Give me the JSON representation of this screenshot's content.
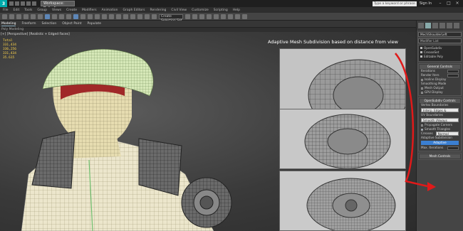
{
  "app": {
    "workspace": "Workspace: Default",
    "search_placeholder": "Type a keyword or phrase",
    "sign_in": "Sign In"
  },
  "menu": [
    "File",
    "Edit",
    "Tools",
    "Group",
    "Views",
    "Create",
    "Modifiers",
    "Animation",
    "Graph Editors",
    "Rendering",
    "Civil View",
    "Customize",
    "Scripting",
    "Help"
  ],
  "toolbar": {
    "view_select": "Create Selection Set"
  },
  "ribbon": {
    "tabs": [
      "Modeling",
      "Freeform",
      "Selection",
      "Object Paint",
      "Populate"
    ],
    "active": "Modeling",
    "sub": "Poly Modeling"
  },
  "viewport": {
    "label": "[+] [Perspective] [Realistic + Edged Faces]",
    "stats": [
      "Total",
      "331,434",
      "336,256",
      "331,434",
      "",
      "35.615"
    ],
    "caption": "Adaptive Mesh Subdivision based on distance from view"
  },
  "command_panel": {
    "object_name": "MechShoulderLeft",
    "modifier_list": "Modifier List",
    "stack": [
      "OpenSubdiv",
      "CreaseSet",
      "Editable Poly"
    ],
    "general_controls": "General Controls",
    "rows": [
      {
        "label": "Iterations",
        "checked": false
      },
      {
        "label": "Render Iters",
        "checked": false
      },
      {
        "label": "Isoline Display",
        "checked": false
      },
      {
        "label": "Smoothing Mode",
        "checked": false
      },
      {
        "label": "Mesh Output",
        "checked": false
      },
      {
        "label": "GPU Display",
        "checked": false
      }
    ],
    "opensubdiv_controls": "OpenSubdiv Controls",
    "vertex_boundaries": "Vertex Boundaries",
    "vertex_boundaries_value": "Interp. Edges & Corners",
    "uv_boundaries": "UV Boundaries",
    "uv_boundaries_value": "Smooth (Always Sharp)",
    "propagate_corners": "Propagate Corners",
    "smooth_triangles": "Smooth Triangles",
    "creases": "Creases",
    "creases_value": "Normal",
    "adaptive_subdivision": "Adaptive Subdivision",
    "adaptive_button": "Adaptive",
    "max_iterations": "Max. Iterations",
    "mesh_controls": "Mesh Controls"
  }
}
